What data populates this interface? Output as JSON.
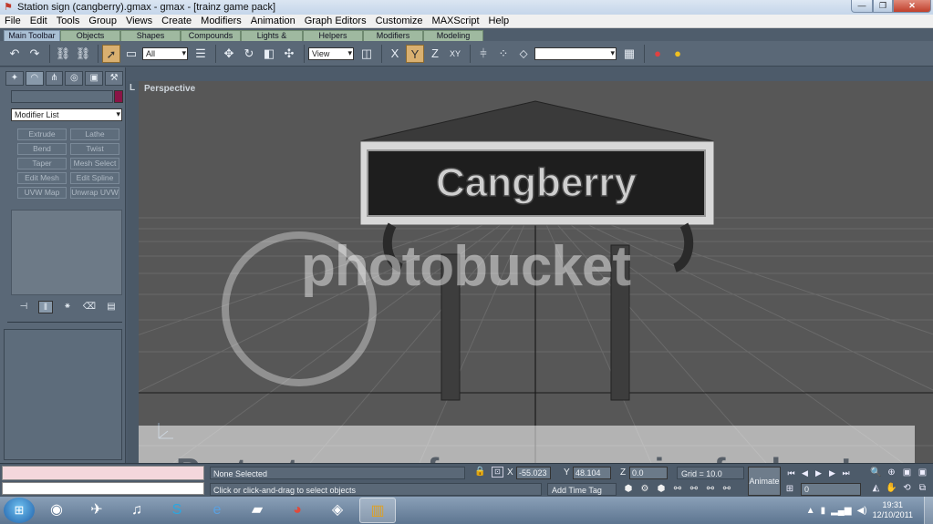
{
  "window": {
    "title": "Station sign (cangberry).gmax - gmax - [trainz game pack]",
    "controls": {
      "minimize": "—",
      "maximize": "❐",
      "close": "✕"
    }
  },
  "menu": [
    "File",
    "Edit",
    "Tools",
    "Group",
    "Views",
    "Create",
    "Modifiers",
    "Animation",
    "Graph Editors",
    "Customize",
    "MAXScript",
    "Help"
  ],
  "tabs": [
    "Main Toolbar",
    "Objects",
    "Shapes",
    "Compounds",
    "Lights & Cameras",
    "Helpers",
    "Modifiers",
    "Modeling"
  ],
  "toolbar": {
    "selection_filter": "All",
    "reference_coord": "View",
    "axis_x": "X",
    "axis_y": "Y",
    "axis_z": "Z",
    "axis_xy": "XY"
  },
  "command_panel": {
    "modifier_list": "Modifier List",
    "modifier_buttons": [
      "Extrude",
      "Lathe",
      "Bend",
      "Twist",
      "Taper",
      "Mesh Select",
      "Edit Mesh",
      "Edit Spline",
      "UVW Map",
      "Unwrap UVW"
    ]
  },
  "viewport": {
    "label": "Perspective",
    "corner_label": "L",
    "sign_text": "Cangberry"
  },
  "watermark": {
    "logo": "photobucket",
    "banner": "Protect more of your memories for less!"
  },
  "status": {
    "selection": "None Selected",
    "prompt": "Click or click-and-drag to select objects",
    "x_label": "X",
    "x_value": "-55.023",
    "y_label": "Y",
    "y_value": "48.104",
    "z_label": "Z",
    "z_value": "0.0",
    "grid": "Grid = 10.0",
    "animate": "Animate",
    "add_time_tag": "Add Time Tag",
    "frame": "0"
  },
  "taskbar": {
    "time": "19:31",
    "date": "12/10/2011"
  },
  "colors": {
    "object_color": "#8a1446",
    "viewport_bg": "#575757",
    "ui_bg": "#5a6877"
  }
}
